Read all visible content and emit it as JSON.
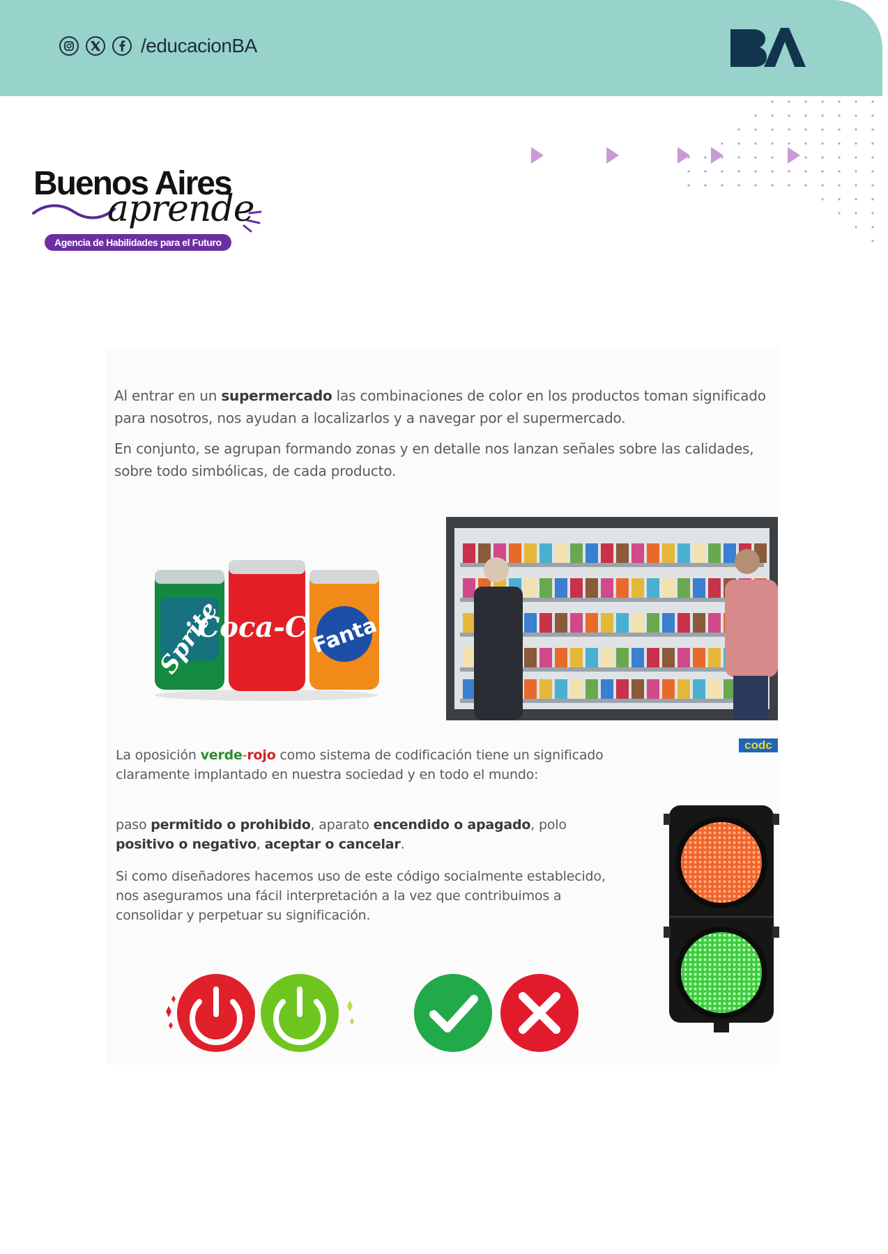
{
  "header": {
    "social_icons": [
      "instagram-icon",
      "x-icon",
      "facebook-icon"
    ],
    "handle": "/educacionBA",
    "logo_text": "BA",
    "background": "#97d3cb"
  },
  "brand": {
    "title": "Buenos Aires",
    "script": "aprende",
    "tagline": "Agencia de Habilidades para el Futuro",
    "accent": "#6b2fa3"
  },
  "content": {
    "p1_a": "Al entrar en un ",
    "p1_b": "supermercado",
    "p1_c": " las combinaciones de color en los productos toman significado para nosotros, nos ayudan a localizarlos y a navegar por el supermercado.",
    "p2": "En conjunto, se agrupan formando zonas y en detalle nos lanzan señales sobre las calidades, sobre todo simbólicas, de cada producto.",
    "p3_a": "La oposición ",
    "p3_green": "verde",
    "p3_dash": "-",
    "p3_red": "rojo",
    "p3_c": " como sistema de codificación tiene un significado claramente implantado en nuestra sociedad y en todo el mundo:",
    "p4_a": "paso ",
    "p4_b": "permitido o prohibido",
    "p4_c": ", aparato ",
    "p4_d": "encendido o apagado",
    "p4_e": ", polo ",
    "p4_f": "positivo o negativo",
    "p4_g": ", ",
    "p4_h": "aceptar o cancelar",
    "p4_i": ".",
    "p5": "Si como diseñadores hacemos uso de este código socialmente establecido, nos aseguramos una fácil interpretación a la vez que contribuimos a consolidar y perpetuar su significación.",
    "badge": "codc"
  },
  "images": {
    "cans": {
      "labels": [
        "Sprite",
        "Coca-Col",
        "Fanta"
      ]
    },
    "market": "supermarket-shelf-photo",
    "traffic_light": "traffic-light-red-green",
    "icons": [
      "power-off-icon",
      "power-on-icon",
      "check-icon",
      "cross-icon"
    ]
  },
  "colors": {
    "green": "#2e8b2e",
    "red": "#d32222",
    "text": "#5a5a5a"
  }
}
